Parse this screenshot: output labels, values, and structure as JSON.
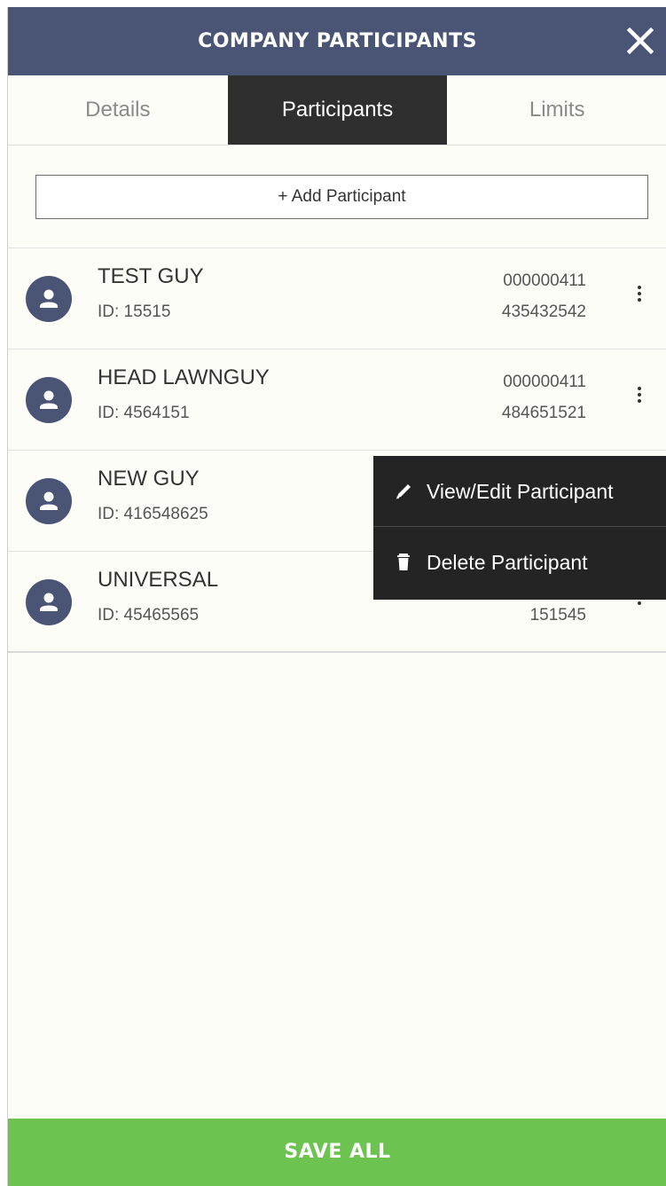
{
  "header": {
    "title": "COMPANY PARTICIPANTS"
  },
  "tabs": [
    {
      "label": "Details",
      "active": false
    },
    {
      "label": "Participants",
      "active": true
    },
    {
      "label": "Limits",
      "active": false
    }
  ],
  "add_button": {
    "label": "+ Add Participant"
  },
  "participants": [
    {
      "name": "TEST GUY",
      "id": "ID: 15515",
      "number1": "000000411",
      "number2": "435432542"
    },
    {
      "name": "HEAD LAWNGUY",
      "id": "ID: 4564151",
      "number1": "000000411",
      "number2": "484651521"
    },
    {
      "name": "NEW GUY",
      "id": "ID: 416548625",
      "number1": "",
      "number2": ""
    },
    {
      "name": "UNIVERSAL",
      "id": "ID: 45465565",
      "number1": "",
      "number2": "151545"
    }
  ],
  "context_menu": {
    "items": [
      {
        "label": "View/Edit Participant",
        "icon": "pencil-icon"
      },
      {
        "label": "Delete Participant",
        "icon": "trash-icon"
      }
    ]
  },
  "footer": {
    "save_label": "SAVE ALL"
  },
  "colors": {
    "header_bg": "#4a5576",
    "active_tab_bg": "#2f2f2f",
    "menu_bg": "#242424",
    "save_bg": "#6cc34f",
    "avatar_bg": "#4a5576"
  }
}
